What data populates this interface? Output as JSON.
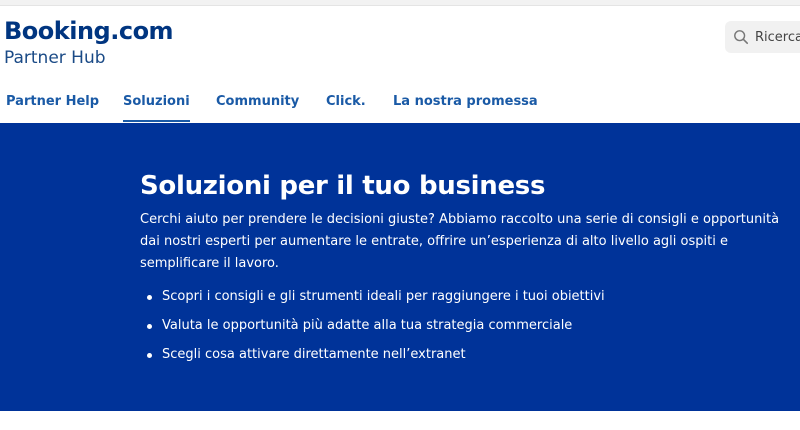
{
  "header": {
    "logo_text": "Booking.com",
    "subtitle": "Partner Hub",
    "search_placeholder": "Ricerca",
    "search_icon": "search-icon"
  },
  "nav": {
    "items": [
      {
        "label": "Partner Help",
        "active": false
      },
      {
        "label": "Soluzioni",
        "active": true
      },
      {
        "label": "Community",
        "active": false
      },
      {
        "label": "Click.",
        "active": false
      },
      {
        "label": "La nostra promessa",
        "active": false
      }
    ]
  },
  "hero": {
    "title": "Soluzioni per il tuo business",
    "description": "Cerchi aiuto per prendere le decisioni giuste? Abbiamo raccolto una serie di consigli e opportunità dai nostri esperti per aumentare le entrate, offrire un’esperienza di alto livello agli ospiti e semplificare il lavoro.",
    "bullets": [
      "Scopri i consigli e gli strumenti ideali per raggiungere i tuoi obiettivi",
      "Valuta le opportunità più adatte alla tua strategia commerciale",
      "Scegli cosa attivare direttamente nell’extranet"
    ],
    "background_color": "#003399"
  },
  "colors": {
    "brand": "#003580",
    "link": "#1a5aa6"
  }
}
